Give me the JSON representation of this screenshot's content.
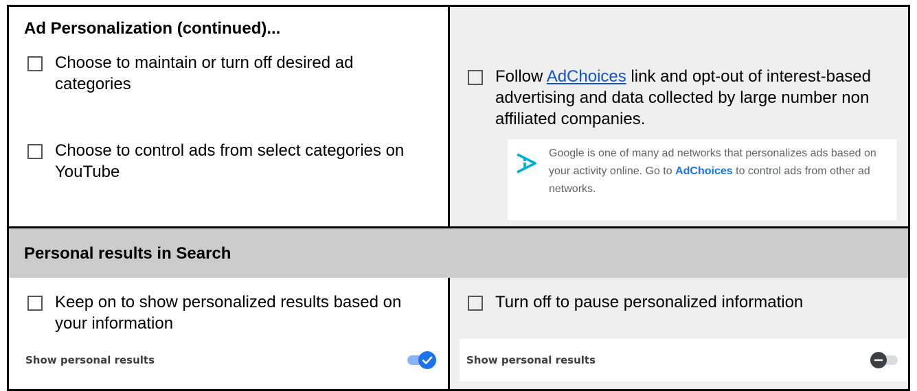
{
  "sections": {
    "ad_personalization": {
      "title": "Ad Personalization (continued)...",
      "left_items": [
        "Choose to maintain or turn off desired ad categories",
        "Choose to control ads from select categories on YouTube"
      ],
      "right_item": {
        "prefix": "Follow ",
        "link_text": "AdChoices",
        "suffix": " link and opt-out of interest-based advertising and data collected by large number non affiliated companies."
      },
      "note": {
        "text_before": "Google is one of many ad networks that personalizes ads based on your activity online. Go to ",
        "link_text": "AdChoices",
        "text_after": " to control ads from other ad networks."
      }
    },
    "personal_results": {
      "title": "Personal results in Search",
      "left_item": "Keep on to show personalized results based on your information",
      "right_item": "Turn off to pause personalized information",
      "left_toggle": {
        "label": "Show personal results",
        "state": "on"
      },
      "right_toggle": {
        "label": "Show personal results",
        "state": "off"
      }
    }
  },
  "icons": {
    "checkbox": "checkbox-icon",
    "adchoices": "adchoices-icon",
    "checkmark": "checkmark-icon",
    "minus": "minus-icon"
  },
  "colors": {
    "link": "#1155cc",
    "header_row": "#cccccc",
    "right_column": "#efefef",
    "toggle_on": "#1a73e8",
    "adchoices_icon": "#00aecd"
  }
}
